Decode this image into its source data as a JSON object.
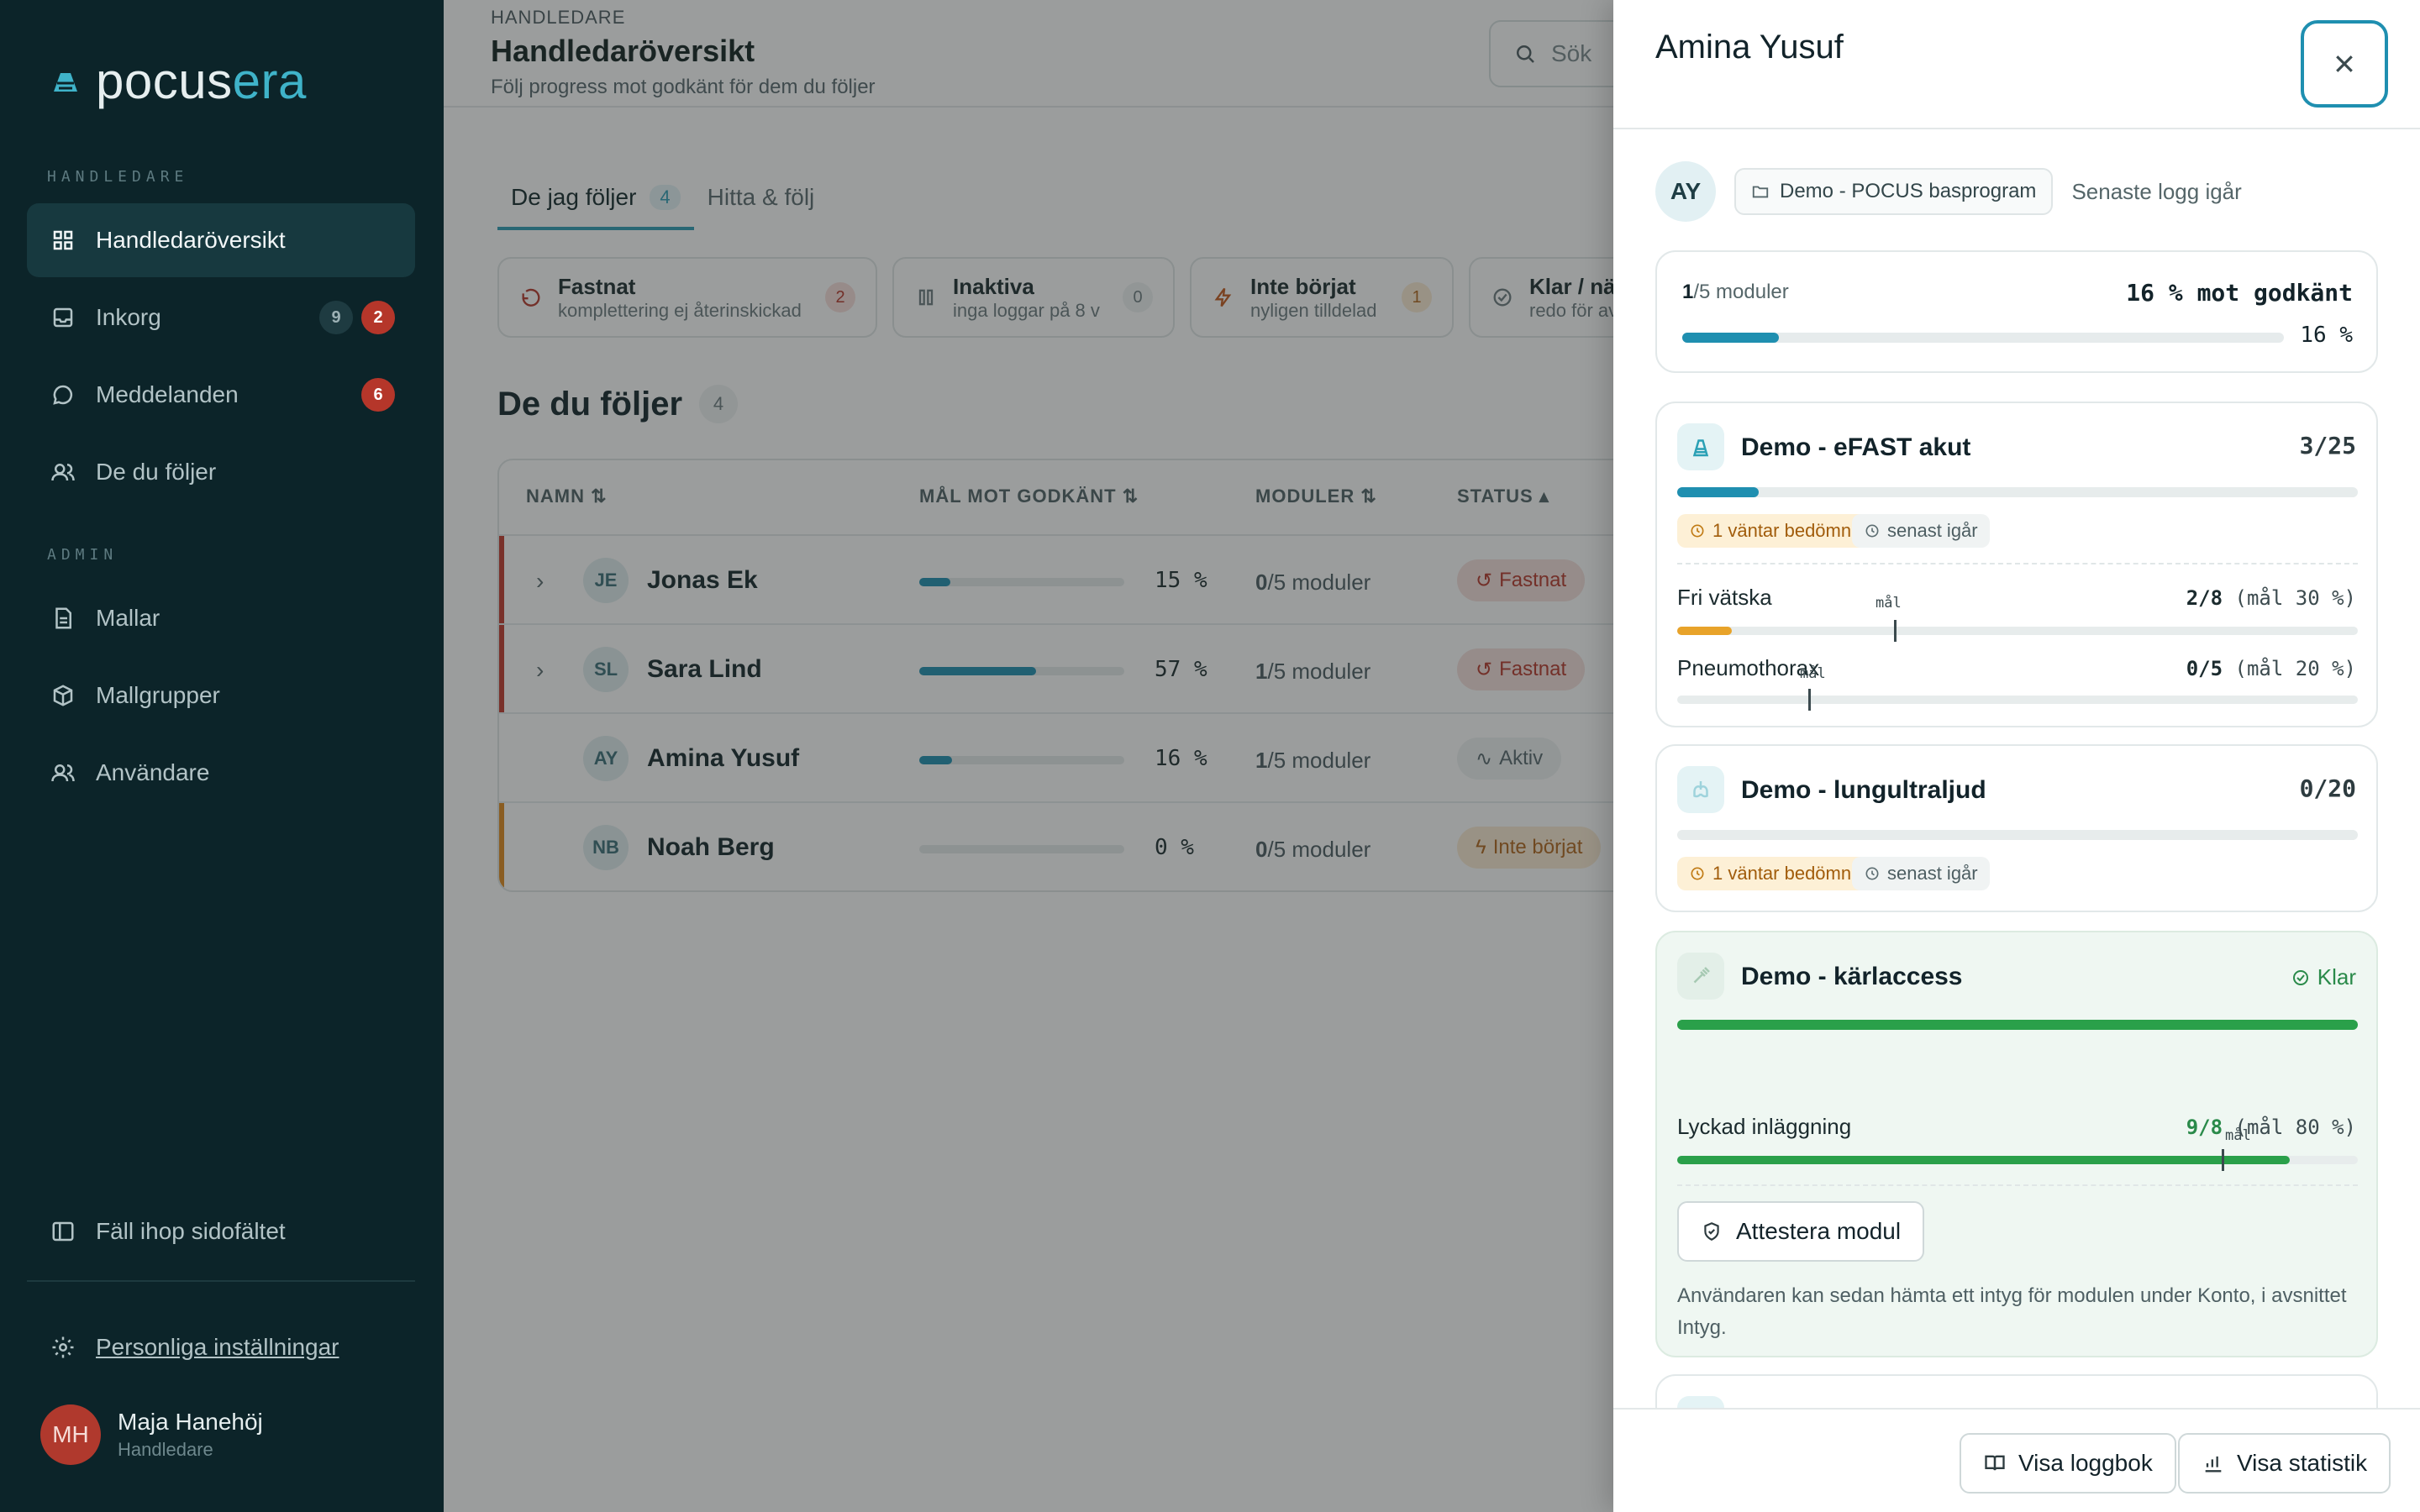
{
  "app": {
    "logo_main": "pocus",
    "logo_accent": "era"
  },
  "sidebar": {
    "section_handledare": "HANDLEDARE",
    "section_admin": "ADMIN",
    "items": [
      {
        "label": "Handledaröversikt",
        "icon": "grid-icon"
      },
      {
        "label": "Inkorg",
        "icon": "inbox-icon",
        "badge_grey": "9",
        "badge_red": "2"
      },
      {
        "label": "Meddelanden",
        "icon": "chat-icon",
        "badge_red": "6"
      },
      {
        "label": "De du följer",
        "icon": "users-icon"
      },
      {
        "label": "Mallar",
        "icon": "document-icon"
      },
      {
        "label": "Mallgrupper",
        "icon": "package-icon"
      },
      {
        "label": "Användare",
        "icon": "users-icon"
      }
    ],
    "collapse_label": "Fäll ihop sidofältet",
    "settings_label": "Personliga inställningar",
    "user": {
      "initials": "MH",
      "name": "Maja Hanehöj",
      "role": "Handledare"
    }
  },
  "main": {
    "eyebrow": "HANDLEDARE",
    "title": "Handledaröversikt",
    "subtitle": "Följ progress mot godkänt för dem du följer",
    "search_placeholder": "Sök",
    "tabs": [
      {
        "label": "De jag följer",
        "count": "4"
      },
      {
        "label": "Hitta & följ"
      }
    ],
    "filters": [
      {
        "title": "Fastnat",
        "sub": "komplettering ej återinskickad",
        "count": "2"
      },
      {
        "title": "Inaktiva",
        "sub": "inga loggar på 8 v",
        "count": "0"
      },
      {
        "title": "Inte börjat",
        "sub": "nyligen tilldelad",
        "count": "1"
      },
      {
        "title": "Klar / när",
        "sub": "redo för av"
      }
    ],
    "section_title": "De du följer",
    "section_count": "4",
    "table": {
      "headers": [
        "NAMN",
        "MÅL MOT GODKÄNT",
        "MODULER",
        "STATUS"
      ],
      "rows": [
        {
          "initials": "JE",
          "name": "Jonas Ek",
          "progress": 0.15,
          "pct": "15 %",
          "mod_done": "0",
          "mod_total": "/5 moduler",
          "status": "Fastnat"
        },
        {
          "initials": "SL",
          "name": "Sara Lind",
          "progress": 0.57,
          "pct": "57 %",
          "mod_done": "1",
          "mod_total": "/5 moduler",
          "status": "Fastnat"
        },
        {
          "initials": "AY",
          "name": "Amina Yusuf",
          "progress": 0.16,
          "pct": "16 %",
          "mod_done": "1",
          "mod_total": "/5 moduler",
          "status": "Aktiv"
        },
        {
          "initials": "NB",
          "name": "Noah Berg",
          "progress": 0.0,
          "pct": "0 %",
          "mod_done": "0",
          "mod_total": "/5 moduler",
          "status": "Inte börjat"
        }
      ]
    }
  },
  "drawer": {
    "title": "Amina Yusuf",
    "initials": "AY",
    "program": "Demo - POCUS basprogram",
    "last_log": "Senaste logg igår",
    "summary": {
      "modules_done": "1",
      "modules_total": "/5 moduler",
      "headline": "16 % mot godkänt",
      "progress": 0.16,
      "pct": "16 %"
    },
    "modules": [
      {
        "title": "Demo - eFAST akut",
        "count": "3/25",
        "progress": 0.12,
        "pending": "1 väntar bedömning",
        "latest": "senast igår",
        "goals": [
          {
            "label": "Fri vätska",
            "val": "2/8",
            "target": "(mål 30 %)",
            "progress": 0.08,
            "mark": 0.32,
            "mark_label": "mål"
          },
          {
            "label": "Pneumothorax",
            "val": "0/5",
            "target": "(mål 20 %)",
            "progress": 0.0,
            "mark": 0.2,
            "mark_label": "mål"
          }
        ]
      },
      {
        "title": "Demo - lungultraljud",
        "count": "0/20",
        "progress": 0.0,
        "pending": "1 väntar bedömning",
        "latest": "senast igår"
      },
      {
        "title": "Demo - kärlaccess",
        "status": "Klar",
        "progress": 1.0,
        "goals": [
          {
            "label": "Lyckad inläggning",
            "val": "9/8",
            "target": "(mål 80 %)",
            "progress": 0.9,
            "mark": 0.8,
            "mark_label": "mål"
          }
        ],
        "attest_label": "Attestera modul",
        "attest_note": "Användaren kan sedan hämta ett intyg för modulen under Konto, i avsnittet Intyg."
      }
    ],
    "footer": {
      "logbook_label": "Visa loggbok",
      "stats_label": "Visa statistik"
    }
  },
  "colors": {
    "accent": "#1f8fb0",
    "danger": "#b5362a",
    "warn": "#e3a02a",
    "success": "#2aa04a",
    "sidebar_bg": "#0c2429"
  }
}
